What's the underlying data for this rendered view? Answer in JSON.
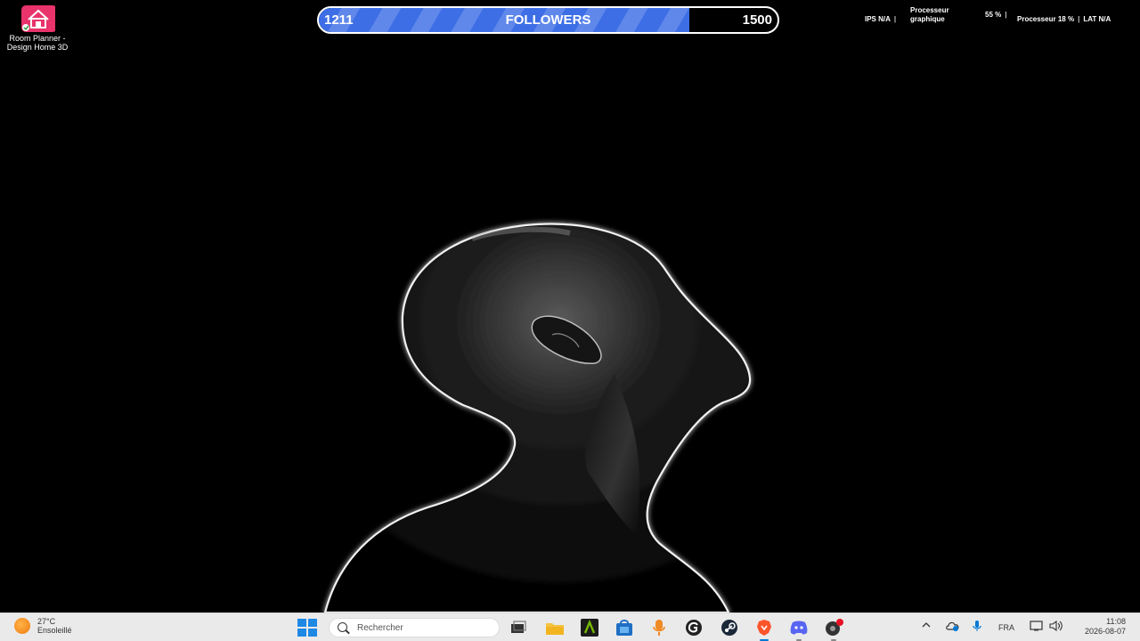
{
  "desktop": {
    "icons": [
      {
        "label_line1": "Room Planner -",
        "label_line2": "Design Home 3D",
        "icon": "house-icon"
      }
    ]
  },
  "followers_widget": {
    "current": "1211",
    "title": "FOLLOWERS",
    "goal": "1500",
    "progress": 0.807,
    "fill_color": "#3d6ee6"
  },
  "perf_overlay": {
    "fps_label": "IPS",
    "fps_value": "N/A",
    "gpu_label_line1": "Processeur",
    "gpu_label_line2": "graphique",
    "gpu_value": "55 %",
    "cpu_label": "Processeur",
    "cpu_value": "18 %",
    "lat_label": "LAT",
    "lat_value": "N/A"
  },
  "taskbar": {
    "weather_temp": "27°C",
    "weather_desc": "Ensoleillé",
    "search_placeholder": "Rechercher",
    "apps": [
      "task-view-icon",
      "file-explorer-icon",
      "nvidia-app-icon",
      "store-icon",
      "microphone-app-icon",
      "g-app-icon",
      "steam-icon",
      "brave-icon",
      "discord-icon",
      "notification-app-icon"
    ],
    "language": "FRA",
    "time": "11:08",
    "date": "2026-08-07"
  }
}
